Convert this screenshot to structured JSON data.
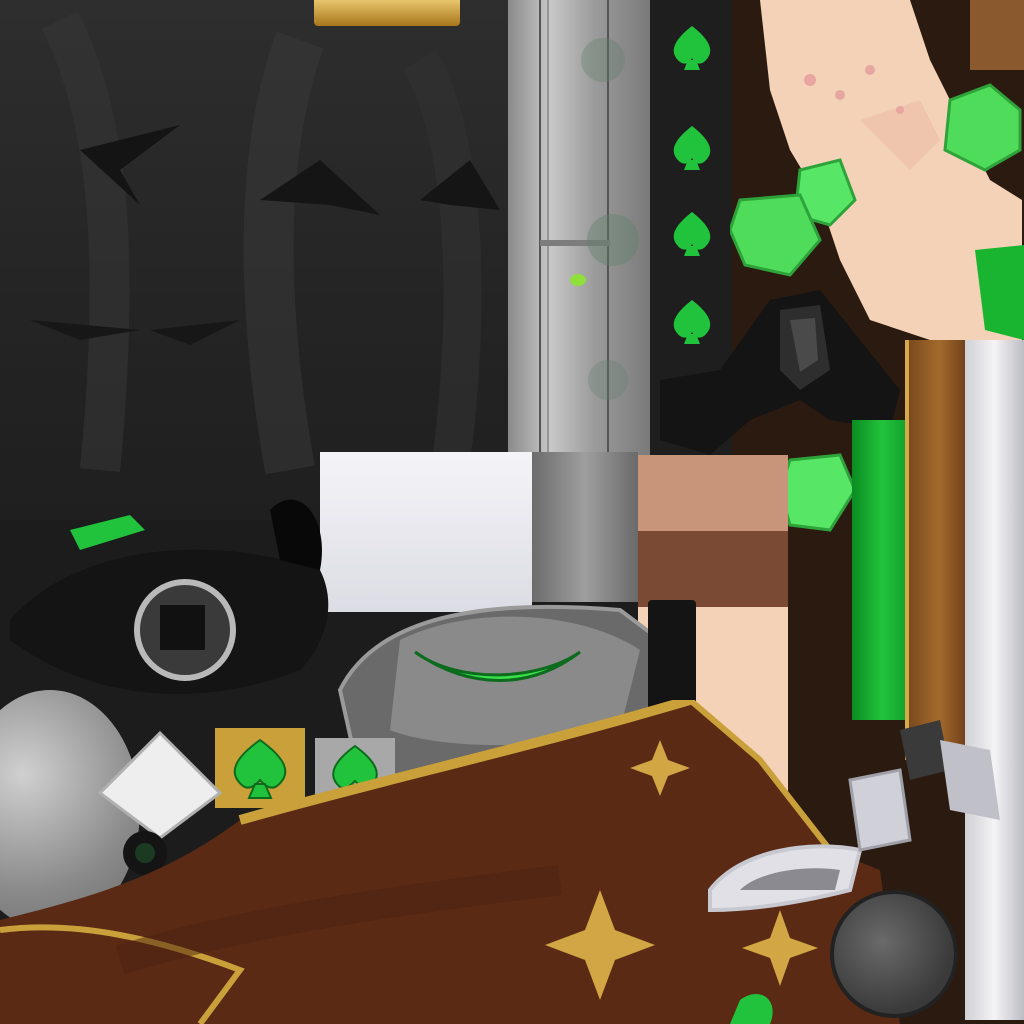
{
  "texture": {
    "description_free": true,
    "colors": {
      "dark_cloth": "#2a2a2a",
      "steel": "#9a9a9a",
      "emerald": "#22c33c",
      "brown_cloth": "#5a2a14",
      "gold_trim": "#c9a03a",
      "skin": "#f3d2b8",
      "white_plate": "#e8e8ec"
    },
    "regions": {
      "dark_cloth_panel": {
        "icon": "dark-fabric"
      },
      "steel_strip": {
        "icon": "metal-strip"
      },
      "spade_column": {
        "icon": "spade-column",
        "spade_count": 4
      },
      "skin_hands": {
        "icon": "hand-skin"
      },
      "gem_cluster": {
        "icon": "emerald-gems"
      },
      "visor_mask": {
        "icon": "mask-visor"
      },
      "spade_badges": {
        "icon": "spade-badge",
        "count": 2
      },
      "brown_coat": {
        "icon": "coat-fabric"
      },
      "gold_sparkles": {
        "icon": "four-point-star",
        "count": 3
      }
    }
  }
}
